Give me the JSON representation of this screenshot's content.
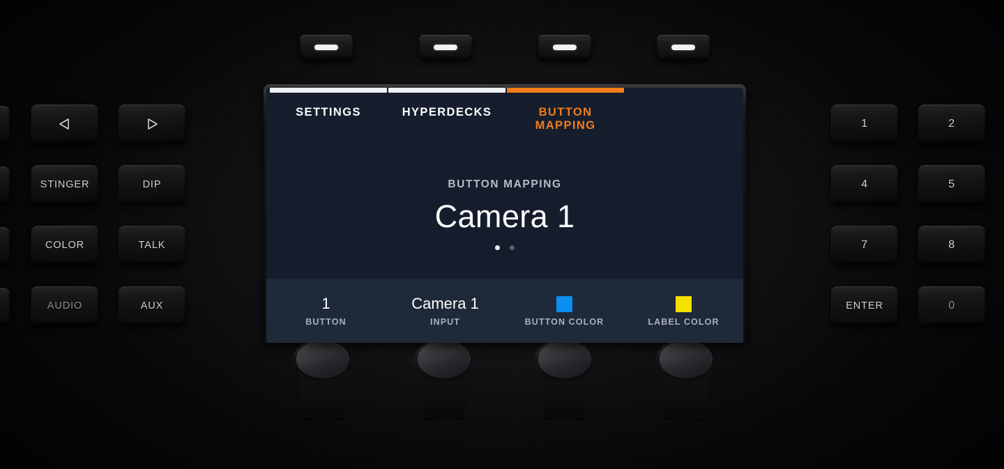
{
  "device": {
    "name": "broadcast-switcher-panel"
  },
  "soft_keys": [
    {
      "name": "soft-key-1",
      "indicator": "dash"
    },
    {
      "name": "soft-key-2",
      "indicator": "dash"
    },
    {
      "name": "soft-key-3",
      "indicator": "dash"
    },
    {
      "name": "soft-key-4",
      "indicator": "dash"
    }
  ],
  "lcd": {
    "tabs": [
      {
        "label": "SETTINGS",
        "active": false
      },
      {
        "label": "HYPERDECKS",
        "active": false
      },
      {
        "label": "BUTTON\nMAPPING",
        "active": true
      }
    ],
    "main": {
      "caption": "BUTTON MAPPING",
      "value": "Camera 1"
    },
    "pager": {
      "total": 2,
      "current": 1
    },
    "parameters": [
      {
        "label": "BUTTON",
        "value": "1",
        "type": "text"
      },
      {
        "label": "INPUT",
        "value": "Camera 1",
        "type": "text"
      },
      {
        "label": "BUTTON COLOR",
        "value": "",
        "type": "color",
        "color": "#0b8ef0"
      },
      {
        "label": "LABEL COLOR",
        "value": "",
        "type": "color",
        "color": "#f5e000"
      }
    ]
  },
  "knobs": [
    {
      "name": "knob-button"
    },
    {
      "name": "knob-input"
    },
    {
      "name": "knob-button-color"
    },
    {
      "name": "knob-label-color"
    }
  ],
  "left_keys": [
    {
      "name": "nav-previous-button",
      "label": "",
      "icon": "triangle-left-icon",
      "dim": false
    },
    {
      "name": "nav-next-button",
      "label": "",
      "icon": "triangle-right-icon",
      "dim": false
    },
    {
      "name": "stinger-button",
      "label": "STINGER",
      "icon": "",
      "dim": false
    },
    {
      "name": "dip-button",
      "label": "DIP",
      "icon": "",
      "dim": false
    },
    {
      "name": "color-button",
      "label": "COLOR",
      "icon": "",
      "dim": false
    },
    {
      "name": "talk-button",
      "label": "TALK",
      "icon": "",
      "dim": false
    },
    {
      "name": "audio-button",
      "label": "AUDIO",
      "icon": "",
      "dim": true
    },
    {
      "name": "aux-button",
      "label": "AUX",
      "icon": "",
      "dim": false
    }
  ],
  "left_cut_keys": [
    {
      "name": "left-edge-key-1"
    },
    {
      "name": "left-edge-key-2"
    },
    {
      "name": "left-edge-key-3"
    },
    {
      "name": "left-edge-key-4"
    }
  ],
  "keypad": [
    {
      "name": "keypad-1",
      "label": "1"
    },
    {
      "name": "keypad-2",
      "label": "2"
    },
    {
      "name": "keypad-4",
      "label": "4"
    },
    {
      "name": "keypad-5",
      "label": "5"
    },
    {
      "name": "keypad-7",
      "label": "7"
    },
    {
      "name": "keypad-8",
      "label": "8"
    },
    {
      "name": "keypad-enter",
      "label": "ENTER"
    },
    {
      "name": "keypad-0",
      "label": "0"
    }
  ],
  "colors": {
    "accent_orange": "#f07d1a",
    "lcd_background": "#151d2d",
    "lcd_footer": "#1e2939",
    "panel": "#070708",
    "button_color_swatch": "#0b8ef0",
    "label_color_swatch": "#f5e000"
  }
}
